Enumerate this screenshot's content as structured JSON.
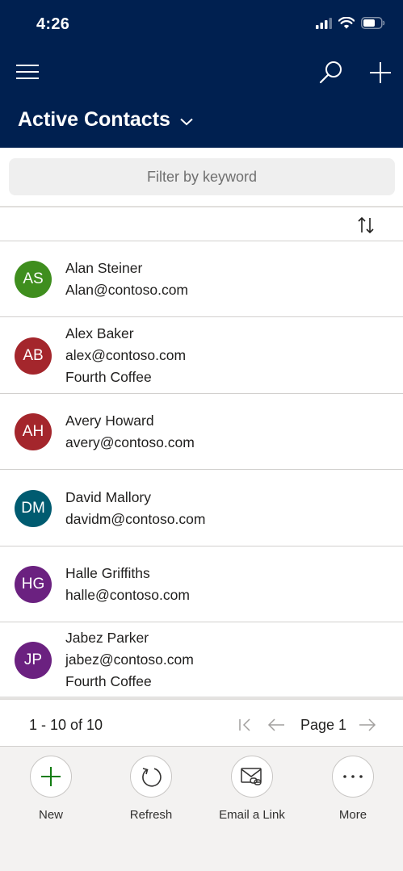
{
  "status_bar": {
    "time": "4:26"
  },
  "header": {
    "view_title": "Active Contacts"
  },
  "filter": {
    "placeholder": "Filter by keyword"
  },
  "contacts": [
    {
      "initials": "AS",
      "color": "#3f8e1e",
      "lines": [
        "Alan Steiner",
        "Alan@contoso.com"
      ]
    },
    {
      "initials": "AB",
      "color": "#a4262c",
      "lines": [
        "Alex Baker",
        "alex@contoso.com",
        "Fourth Coffee"
      ]
    },
    {
      "initials": "AH",
      "color": "#a4262c",
      "lines": [
        "Avery Howard",
        "avery@contoso.com"
      ]
    },
    {
      "initials": "DM",
      "color": "#005b70",
      "lines": [
        "David Mallory",
        "davidm@contoso.com"
      ]
    },
    {
      "initials": "HG",
      "color": "#6b2180",
      "lines": [
        "Halle Griffiths",
        "halle@contoso.com"
      ]
    },
    {
      "initials": "JP",
      "color": "#6b2180",
      "lines": [
        "Jabez Parker",
        "jabez@contoso.com",
        "Fourth Coffee"
      ]
    }
  ],
  "pager": {
    "count": "1 - 10 of 10",
    "page": "Page 1"
  },
  "commands": {
    "new": "New",
    "refresh": "Refresh",
    "email_link": "Email a Link",
    "more": "More"
  },
  "colors": {
    "header_bg": "#002050",
    "accent_green": "#107c10",
    "command_icon": "#323130"
  }
}
